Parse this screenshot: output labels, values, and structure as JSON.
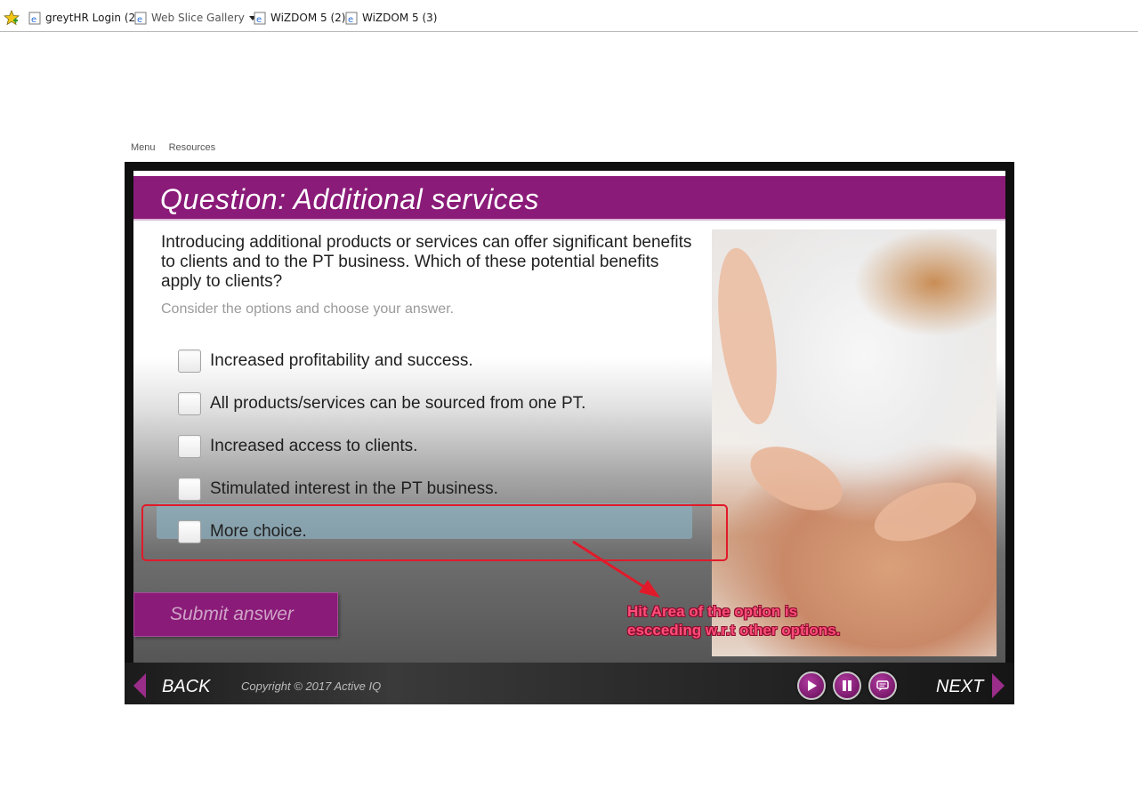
{
  "favorites": {
    "items": [
      {
        "label": "greytHR Login (2)"
      },
      {
        "label": "Web Slice Gallery"
      },
      {
        "label": "WiZDOM 5 (2)"
      },
      {
        "label": "WiZDOM 5 (3)"
      }
    ]
  },
  "player_menu": {
    "menu": "Menu",
    "resources": "Resources"
  },
  "slide": {
    "title": "Question: Additional services",
    "question": "Introducing additional products or services can offer significant benefits to clients and to the PT business. Which of these potential benefits apply to clients?",
    "instruction": "Consider the options and choose your answer.",
    "options": [
      {
        "label": "Increased profitability and success.",
        "checked": false
      },
      {
        "label": "All products/services can be sourced from one PT.",
        "checked": false
      },
      {
        "label": "Increased access to clients.",
        "checked": false
      },
      {
        "label": "Stimulated interest in the PT business.",
        "checked": false
      },
      {
        "label": "More choice.",
        "checked": false
      }
    ],
    "submit_label": "Submit answer"
  },
  "navbar": {
    "back": "BACK",
    "copyright": "Copyright © 2017 Active IQ",
    "next": "NEXT",
    "controls": [
      "play-icon",
      "pause-icon",
      "transcript-icon"
    ]
  },
  "annotation": {
    "text": "Hit Area of the option is escceding w.r.t other options.",
    "color": "#e11a2a"
  },
  "colors": {
    "brand": "#8a1b78"
  }
}
